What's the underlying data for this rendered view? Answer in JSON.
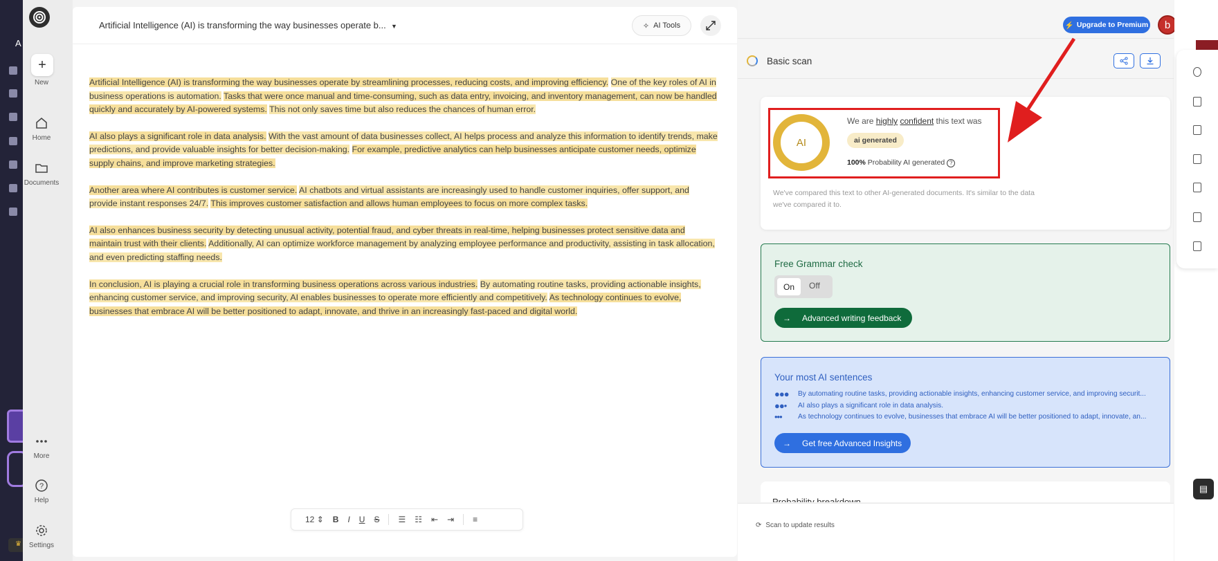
{
  "sidebar": {
    "new_label": "New",
    "home_label": "Home",
    "documents_label": "Documents",
    "more_label": "More",
    "help_label": "Help",
    "settings_label": "Settings",
    "brand_initial": "A"
  },
  "editor": {
    "title": "Artificial Intelligence (AI) is transforming the way businesses operate b...",
    "ai_tools_label": "AI Tools",
    "font_size": "12",
    "paragraphs": [
      [
        "Artificial Intelligence (AI) is transforming the way businesses operate by streamlining processes, reducing costs, and improving efficiency.",
        "One of the key roles of AI in business operations is automation.",
        "Tasks that were once manual and time-consuming, such as data entry, invoicing, and inventory management, can now be handled quickly and accurately by AI-powered systems.",
        "This not only saves time but also reduces the chances of human error."
      ],
      [
        "AI also plays a significant role in data analysis.",
        "With the vast amount of data businesses collect, AI helps process and analyze this information to identify trends, make predictions, and provide valuable insights for better decision-making.",
        "For example, predictive analytics can help businesses anticipate customer needs, optimize supply chains, and improve marketing strategies."
      ],
      [
        "Another area where AI contributes is customer service.",
        "AI chatbots and virtual assistants are increasingly used to handle customer inquiries, offer support, and provide instant responses 24/7.",
        "This improves customer satisfaction and allows human employees to focus on more complex tasks."
      ],
      [
        "AI also enhances business security by detecting unusual activity, potential fraud, and cyber threats in real-time, helping businesses protect sensitive data and maintain trust with their clients.",
        "Additionally, AI can optimize workforce management by analyzing employee performance and productivity, assisting in task allocation, and even predicting staffing needs."
      ],
      [
        "In conclusion, AI is playing a crucial role in transforming business operations across various industries.",
        "By automating routine tasks, providing actionable insights, enhancing customer service, and improving security, AI enables businesses to operate more efficiently and competitively.",
        "As technology continues to evolve, businesses that embrace AI will be better positioned to adapt, innovate, and thrive in an increasingly fast-paced and digital world."
      ]
    ]
  },
  "header": {
    "upgrade_label": "Upgrade to Premium",
    "avatar_initial": "b"
  },
  "scan": {
    "title": "Basic scan",
    "ring_label": "AI",
    "confidence_prefix": "We are ",
    "confidence_level": "highly",
    "confidence_word": "confident",
    "confidence_suffix": " this text was",
    "verdict_badge": "ai generated",
    "probability_value": "100%",
    "probability_label": "Probability AI generated",
    "comparison_note": "We've compared this text to other AI-generated documents. It's similar to the data we've compared it to.",
    "update_label": "Scan to update results"
  },
  "grammar": {
    "title": "Free Grammar check",
    "on_label": "On",
    "off_label": "Off",
    "feedback_button": "Advanced writing feedback"
  },
  "sentences": {
    "title": "Your most AI sentences",
    "items": [
      "By automating routine tasks, providing actionable insights, enhancing customer service, and improving securit...",
      "AI also plays a significant role in data analysis.",
      "As technology continues to evolve, businesses that embrace AI will be better positioned to adapt, innovate, an..."
    ],
    "insights_button": "Get free Advanced Insights"
  },
  "probability_breakdown": {
    "title": "Probability breakdown"
  },
  "colors": {
    "highlight": "#f6df9b",
    "ring": "#e2b53a",
    "annotation_red": "#e01e1e",
    "grammar_green": "#0f6b3b",
    "accent_blue": "#2f6fe0"
  }
}
